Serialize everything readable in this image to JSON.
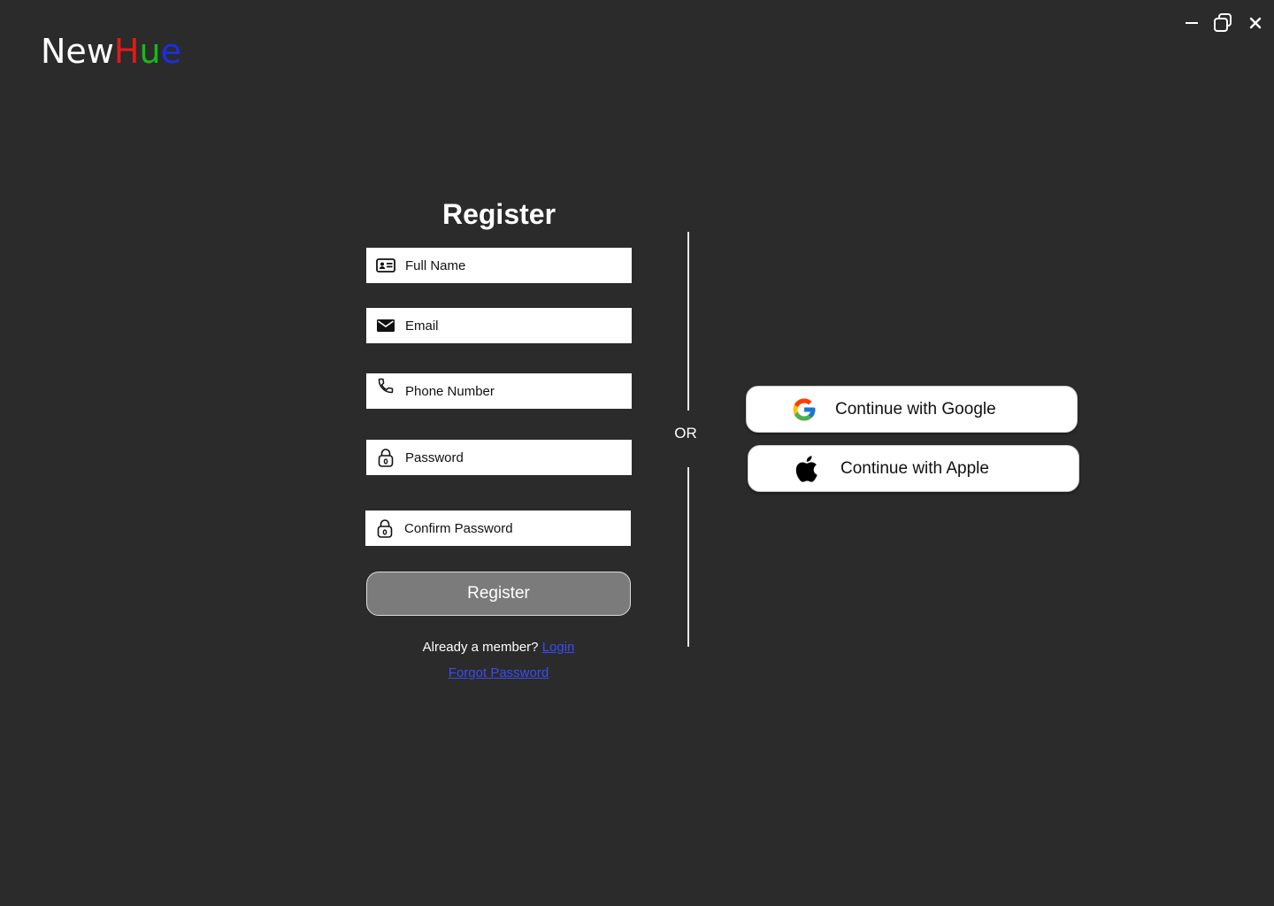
{
  "logo": {
    "part_new": "New",
    "part_h": "H",
    "part_u": "u",
    "part_e": "e"
  },
  "window_controls": {
    "minimize_icon": "minimize-icon",
    "restore_icon": "restore-icon",
    "close_icon": "close-icon"
  },
  "form": {
    "title": "Register",
    "full_name_placeholder": "Full Name",
    "email_placeholder": "Email",
    "phone_placeholder": "Phone Number",
    "password_placeholder": "Password",
    "confirm_password_placeholder": "Confirm Password",
    "register_button": "Register",
    "member_text": "Already a member?",
    "login_link": "Login",
    "forgot_link": "Forgot Password"
  },
  "divider": {
    "or_label": "OR"
  },
  "social": {
    "google_label": "Continue with Google",
    "apple_label": "Continue with Apple"
  },
  "colors": {
    "background": "#2b2b2b",
    "logo_h": "#e11a1a",
    "logo_u": "#18b81a",
    "logo_e": "#1a2ee3",
    "link": "#3a4cf5",
    "register_button": "#7b7b7b"
  }
}
